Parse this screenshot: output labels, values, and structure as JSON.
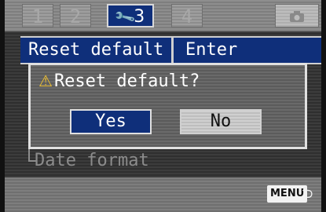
{
  "tabs": [
    {
      "label": "1",
      "active": false
    },
    {
      "label": "2",
      "active": false
    },
    {
      "label": "3",
      "active": true,
      "icon": "wrench-icon"
    },
    {
      "label": "4",
      "active": false
    },
    {
      "label": "",
      "icon": "camera-icon",
      "active": false
    }
  ],
  "menu": {
    "selected_label": "Reset default",
    "selected_value": "Enter",
    "dimmed_item": "Date format"
  },
  "dialog": {
    "title": "Reset default?",
    "yes_label": "Yes",
    "no_label": "No"
  },
  "footer": {
    "menu_label": "MENU",
    "back_icon": "return-arrow-icon"
  },
  "colors": {
    "highlight": "#0f2f7a",
    "warning": "#f2c230"
  }
}
